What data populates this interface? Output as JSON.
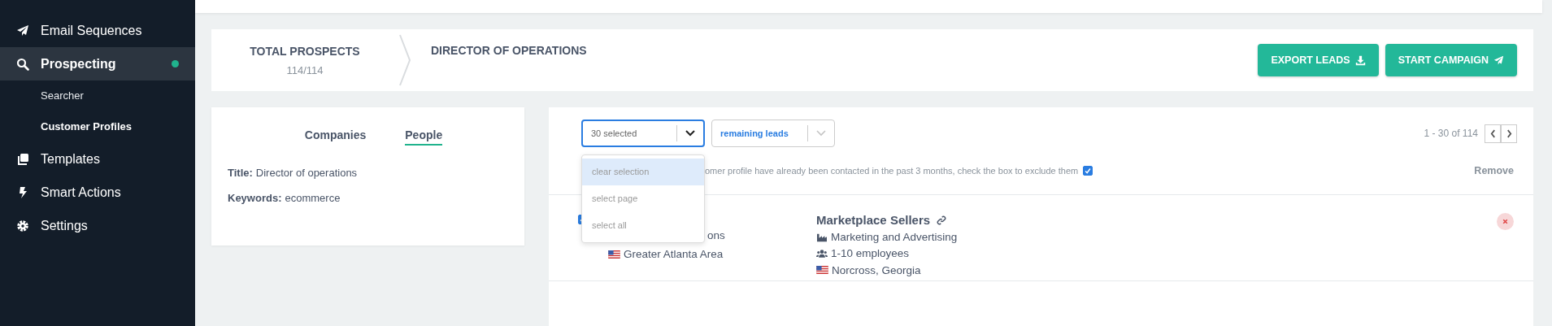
{
  "sidebar": {
    "items": [
      {
        "label": "Email Sequences",
        "selected": false,
        "dot": false
      },
      {
        "label": "Prospecting",
        "selected": true,
        "dot": true,
        "children": [
          {
            "label": "Searcher",
            "selected": false
          },
          {
            "label": "Customer Profiles",
            "selected": true
          }
        ]
      },
      {
        "label": "Templates",
        "selected": false,
        "dot": false
      },
      {
        "label": "Smart Actions",
        "selected": false,
        "dot": false
      },
      {
        "label": "Settings",
        "selected": false,
        "dot": false
      }
    ]
  },
  "header": {
    "total_label": "TOTAL PROSPECTS",
    "total_value": "114/114",
    "profile_title": "DIRECTOR OF OPERATIONS",
    "buttons": [
      {
        "label": "EXPORT LEADS"
      },
      {
        "label": "START CAMPAIGN"
      }
    ]
  },
  "profile": {
    "tabs": [
      {
        "label": "Companies",
        "selected": false
      },
      {
        "label": "People",
        "selected": true
      }
    ],
    "fields": [
      {
        "label": "Title:",
        "value": "Director of operations"
      },
      {
        "label": "Keywords:",
        "value": "ecommerce"
      }
    ]
  },
  "leads": {
    "selection": {
      "value": "30 selected",
      "open": true
    },
    "filter": {
      "value": "remaining leads"
    },
    "menu": [
      {
        "label": "clear selection",
        "highlighted": true
      },
      {
        "label": "select page",
        "highlighted": false
      },
      {
        "label": "select all",
        "highlighted": false
      }
    ],
    "pager": "1 - 30 of 114",
    "notice": "omer profile have already been contacted in the past 3 months, check the box to exclude them",
    "exclude_checked": true,
    "remove_header": "Remove",
    "rows": [
      {
        "checked": true,
        "person_title": "ons",
        "person_location": "Greater Atlanta Area",
        "company": "Marketplace Sellers",
        "industry": "Marketing and Advertising",
        "employees": "1-10 employees",
        "company_location": "Norcross, Georgia"
      }
    ]
  }
}
